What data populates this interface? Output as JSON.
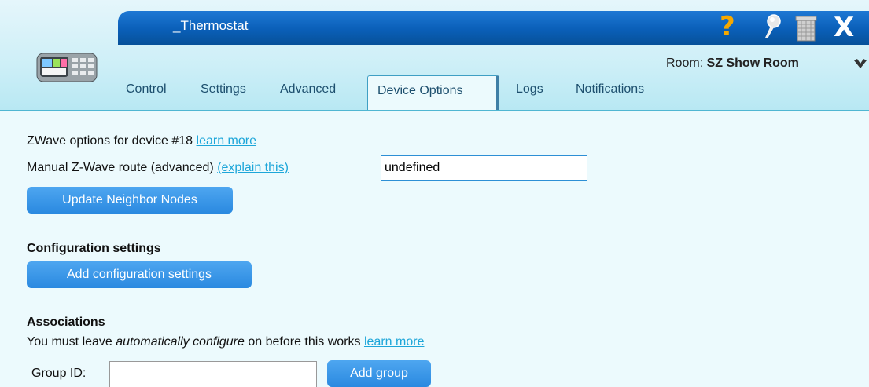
{
  "window": {
    "title": "_Thermostat",
    "room_label": "Room:",
    "room_name": "SZ Show Room"
  },
  "tabs": [
    {
      "label": "Control"
    },
    {
      "label": "Settings"
    },
    {
      "label": "Advanced"
    },
    {
      "label": "Device Options",
      "active": true
    },
    {
      "label": "Logs"
    },
    {
      "label": "Notifications"
    }
  ],
  "zwave": {
    "options_text": "ZWave options for device #18",
    "learn_more": "learn more",
    "route_label": "Manual Z-Wave route (advanced)",
    "explain_link": "(explain this)",
    "route_value": "undefined",
    "update_button": "Update Neighbor Nodes"
  },
  "configuration": {
    "heading": "Configuration settings",
    "add_button": "Add configuration settings"
  },
  "associations": {
    "heading": "Associations",
    "note_before": "You must leave ",
    "note_em": "automatically configure",
    "note_after": " on before this works",
    "learn_more": "learn more",
    "group_label": "Group ID:",
    "group_value": "",
    "add_group_button": "Add group"
  },
  "colors": {
    "titlebar": "#0a5fb8",
    "header_bg": "#cdeff7",
    "content_bg": "#ecfafd",
    "button": "#2a89e0",
    "link": "#1da6d9",
    "help_icon": "#f6a800"
  },
  "icons": [
    "help-icon",
    "pin-icon",
    "trash-icon",
    "close-icon",
    "device-thumbnail-icon",
    "chevron-down-icon"
  ]
}
